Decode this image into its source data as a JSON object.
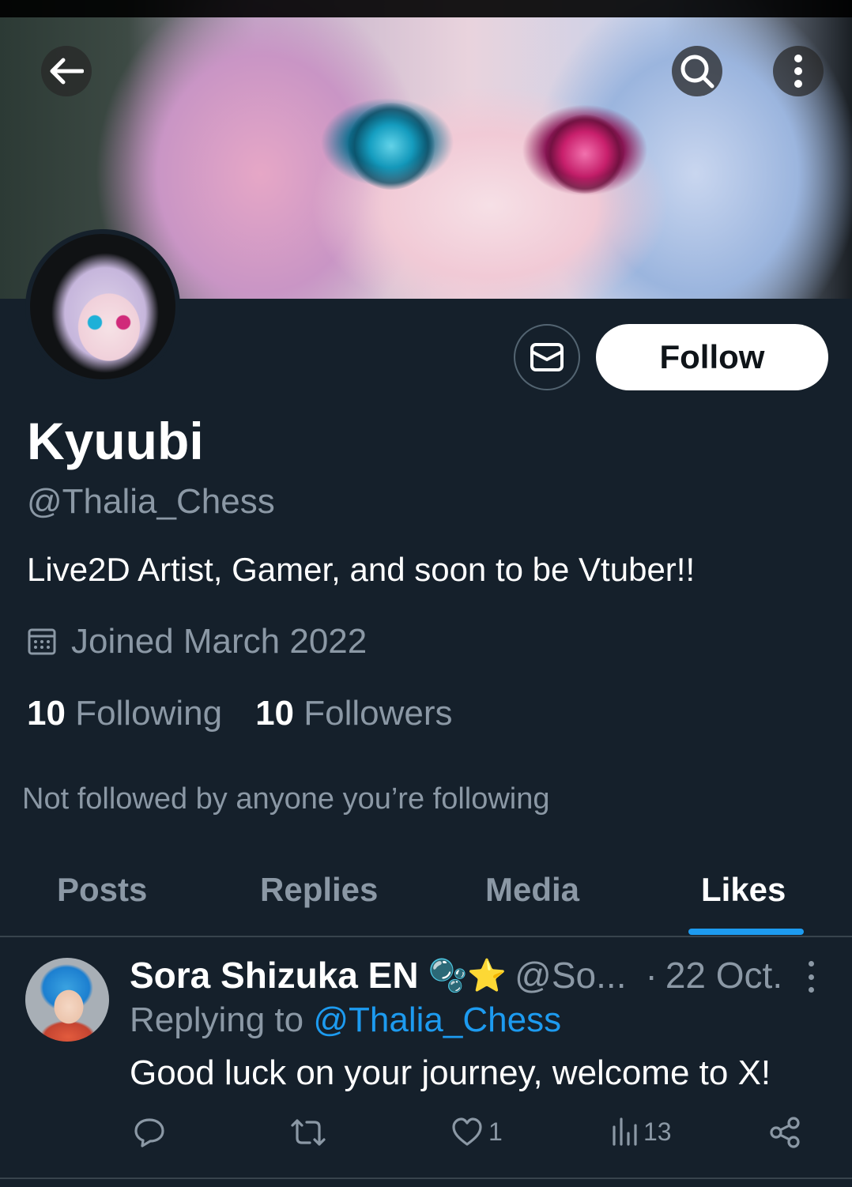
{
  "profile": {
    "name": "Kyuubi",
    "handle": "@Thalia_Chess",
    "bio": "Live2D Artist, Gamer, and soon to be Vtuber!!",
    "joined": "Joined March 2022",
    "following_count": "10",
    "following_label": "Following",
    "followers_count": "10",
    "followers_label": "Followers",
    "not_followed": "Not followed by anyone you’re following",
    "follow_label": "Follow"
  },
  "tabs": [
    {
      "label": "Posts",
      "active": false
    },
    {
      "label": "Replies",
      "active": false
    },
    {
      "label": "Media",
      "active": false
    },
    {
      "label": "Likes",
      "active": true
    }
  ],
  "tweet": {
    "author_name": "Sora Shizuka EN",
    "author_emoji": "🫧⭐",
    "author_handle": "@So...",
    "separator": "·",
    "date": "22 Oct.",
    "replying_prefix": "Replying to",
    "replying_mention": "@Thalia_Chess",
    "text": "Good luck on your journey, welcome to X!",
    "likes": "1",
    "views": "13"
  },
  "colors": {
    "background": "#15202b",
    "accent": "#1d9bf0",
    "secondary_text": "#8b98a5"
  },
  "icons": [
    "back-arrow-icon",
    "search-icon",
    "more-vertical-icon",
    "mail-icon",
    "calendar-icon",
    "reply-icon",
    "retweet-icon",
    "like-icon",
    "views-icon",
    "share-icon"
  ]
}
